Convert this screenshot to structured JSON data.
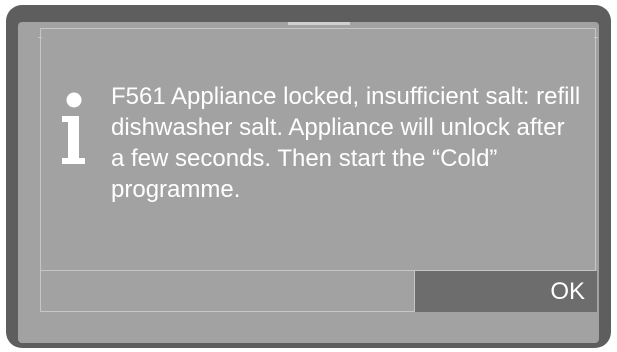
{
  "dialog": {
    "icon": "info-icon",
    "message": "F561 Appliance locked, insufficient salt: refill dishwasher salt. Appliance will unlock after a few seconds. Then start the “Cold” programme.",
    "ok_label": "OK"
  },
  "colors": {
    "bezel": "#5e5e5e",
    "screen": "#a2a2a2",
    "ok_button": "#6d6d6d",
    "text": "#ffffff"
  }
}
